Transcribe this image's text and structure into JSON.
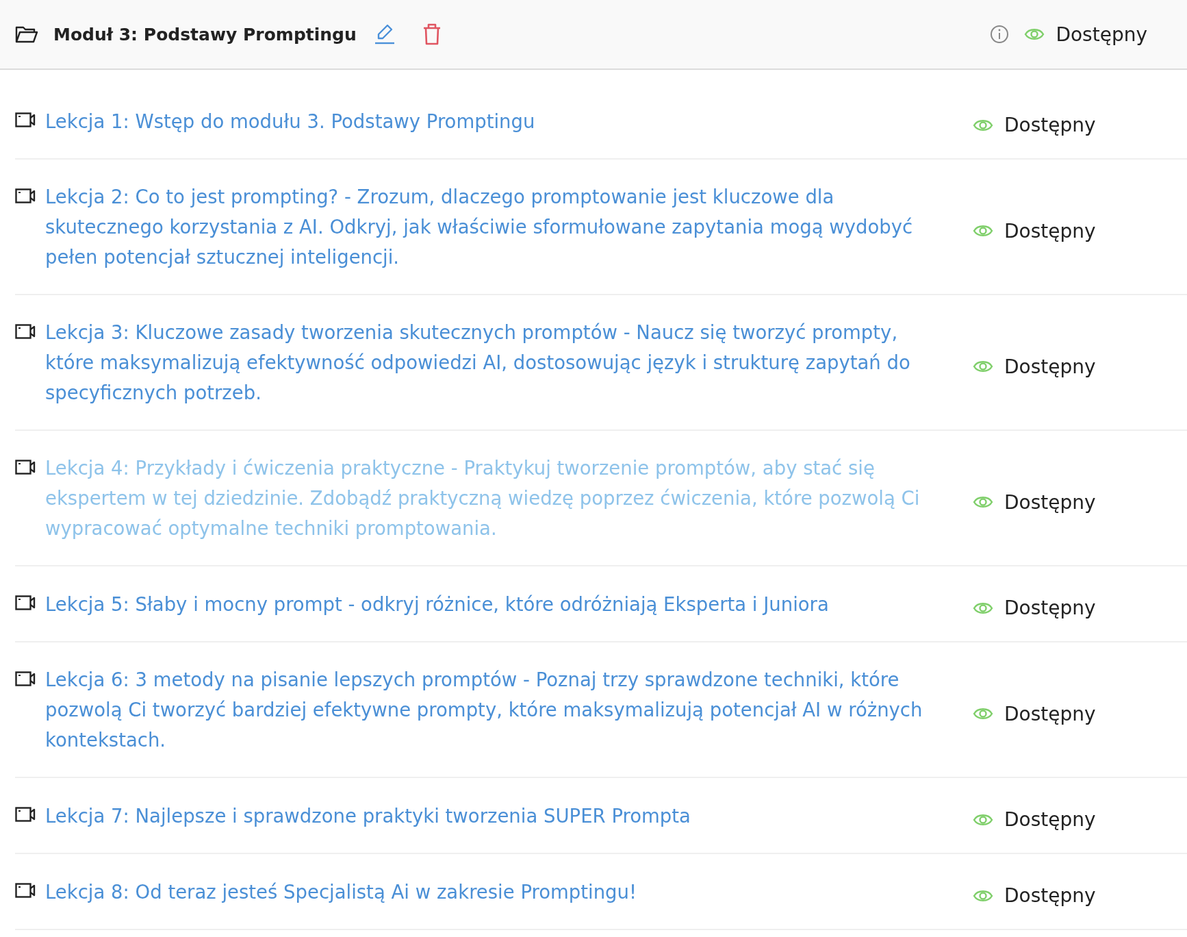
{
  "module": {
    "title": "Moduł 3: Podstawy Promptingu",
    "status": "Dostępny",
    "visible": true
  },
  "lessons": [
    {
      "title": "Lekcja 1: Wstęp do modułu 3. Podstawy Promptingu",
      "status": "Dostępny",
      "visible": true,
      "hovered": false
    },
    {
      "title": "Lekcja 2: Co to jest prompting? - Zrozum, dlaczego promptowanie jest kluczowe dla skutecznego korzystania z AI. Odkryj, jak właściwie sformułowane zapytania mogą wydobyć pełen potencjał sztucznej inteligencji.",
      "status": "Dostępny",
      "visible": true,
      "hovered": false
    },
    {
      "title": "Lekcja 3: Kluczowe zasady tworzenia skutecznych promptów - Naucz się tworzyć prompty, które maksymalizują efektywność odpowiedzi AI, dostosowując język i strukturę zapytań do specyficznych potrzeb.",
      "status": "Dostępny",
      "visible": true,
      "hovered": false
    },
    {
      "title": "Lekcja 4: Przykłady i ćwiczenia praktyczne - Praktykuj tworzenie promptów, aby stać się ekspertem w tej dziedzinie. Zdobądź praktyczną wiedzę poprzez ćwiczenia, które pozwolą Ci wypracować optymalne techniki promptowania.",
      "status": "Dostępny",
      "visible": true,
      "hovered": true
    },
    {
      "title": "Lekcja 5: Słaby i mocny prompt - odkryj różnice, które odróżniają Eksperta i Juniora",
      "status": "Dostępny",
      "visible": true,
      "hovered": false
    },
    {
      "title": "Lekcja 6: 3 metody na pisanie lepszych promptów - Poznaj trzy sprawdzone techniki, które pozwolą Ci tworzyć bardziej efektywne prompty, które maksymalizują potencjał AI w różnych kontekstach.",
      "status": "Dostępny",
      "visible": true,
      "hovered": false
    },
    {
      "title": "Lekcja 7: Najlepsze i sprawdzone praktyki tworzenia SUPER Prompta",
      "status": "Dostępny",
      "visible": true,
      "hovered": false
    },
    {
      "title": "Lekcja 8: Od teraz jesteś Specjalistą Ai w zakresie Promptingu!",
      "status": "Dostępny",
      "visible": true,
      "hovered": false
    }
  ]
}
